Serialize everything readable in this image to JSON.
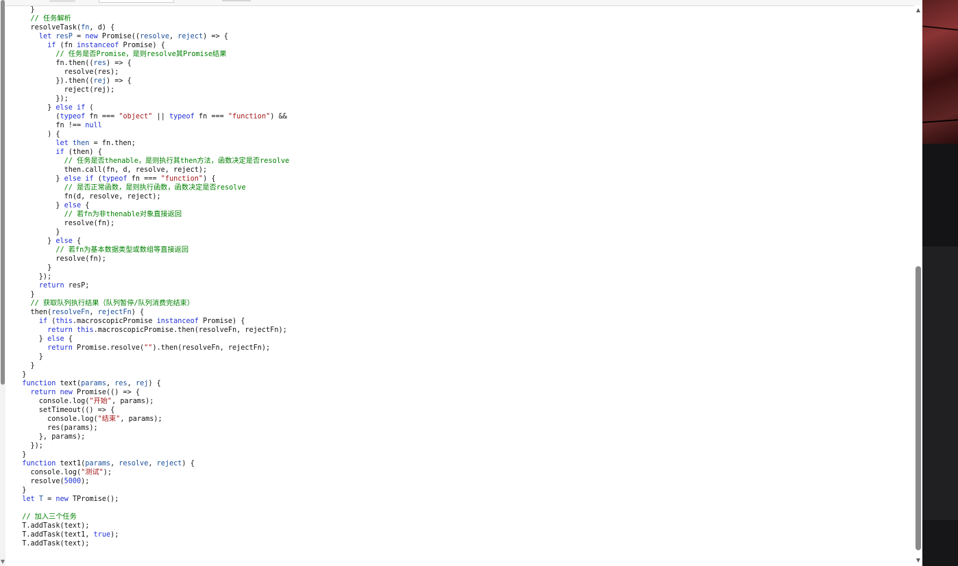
{
  "code": {
    "lines": [
      [
        {
          "t": "    }",
          "c": "plain"
        }
      ],
      [
        {
          "t": "    ",
          "c": "plain"
        },
        {
          "t": "// 任务解析",
          "c": "com"
        }
      ],
      [
        {
          "t": "    resolveTask(",
          "c": "plain"
        },
        {
          "t": "fn",
          "c": "param"
        },
        {
          "t": ", d) {",
          "c": "plain"
        }
      ],
      [
        {
          "t": "      ",
          "c": "plain"
        },
        {
          "t": "let",
          "c": "kw"
        },
        {
          "t": " ",
          "c": "plain"
        },
        {
          "t": "resP",
          "c": "param"
        },
        {
          "t": " = ",
          "c": "plain"
        },
        {
          "t": "new",
          "c": "kw"
        },
        {
          "t": " Promise((",
          "c": "plain"
        },
        {
          "t": "resolve",
          "c": "param"
        },
        {
          "t": ", ",
          "c": "plain"
        },
        {
          "t": "reject",
          "c": "param"
        },
        {
          "t": ") => {",
          "c": "plain"
        }
      ],
      [
        {
          "t": "        ",
          "c": "plain"
        },
        {
          "t": "if",
          "c": "kw"
        },
        {
          "t": " (fn ",
          "c": "plain"
        },
        {
          "t": "instanceof",
          "c": "kw"
        },
        {
          "t": " Promise) {",
          "c": "plain"
        }
      ],
      [
        {
          "t": "          ",
          "c": "plain"
        },
        {
          "t": "// 任务是否Promise，是则resolve其Promise结果",
          "c": "com"
        }
      ],
      [
        {
          "t": "          fn.then((",
          "c": "plain"
        },
        {
          "t": "res",
          "c": "param"
        },
        {
          "t": ") => {",
          "c": "plain"
        }
      ],
      [
        {
          "t": "            resolve(res);",
          "c": "plain"
        }
      ],
      [
        {
          "t": "          }).then((",
          "c": "plain"
        },
        {
          "t": "rej",
          "c": "param"
        },
        {
          "t": ") => {",
          "c": "plain"
        }
      ],
      [
        {
          "t": "            reject(rej);",
          "c": "plain"
        }
      ],
      [
        {
          "t": "          });",
          "c": "plain"
        }
      ],
      [
        {
          "t": "        } ",
          "c": "plain"
        },
        {
          "t": "else if",
          "c": "kw"
        },
        {
          "t": " (",
          "c": "plain"
        }
      ],
      [
        {
          "t": "          (",
          "c": "plain"
        },
        {
          "t": "typeof",
          "c": "kw"
        },
        {
          "t": " fn === ",
          "c": "plain"
        },
        {
          "t": "\"object\"",
          "c": "str"
        },
        {
          "t": " || ",
          "c": "plain"
        },
        {
          "t": "typeof",
          "c": "kw"
        },
        {
          "t": " fn === ",
          "c": "plain"
        },
        {
          "t": "\"function\"",
          "c": "str"
        },
        {
          "t": ") &&",
          "c": "plain"
        }
      ],
      [
        {
          "t": "          fn !== ",
          "c": "plain"
        },
        {
          "t": "null",
          "c": "kw"
        }
      ],
      [
        {
          "t": "        ) {",
          "c": "plain"
        }
      ],
      [
        {
          "t": "          ",
          "c": "plain"
        },
        {
          "t": "let",
          "c": "kw"
        },
        {
          "t": " ",
          "c": "plain"
        },
        {
          "t": "then",
          "c": "param"
        },
        {
          "t": " = fn.then;",
          "c": "plain"
        }
      ],
      [
        {
          "t": "          ",
          "c": "plain"
        },
        {
          "t": "if",
          "c": "kw"
        },
        {
          "t": " (then) {",
          "c": "plain"
        }
      ],
      [
        {
          "t": "            ",
          "c": "plain"
        },
        {
          "t": "// 任务是否thenable，是则执行其then方法，函数决定是否resolve",
          "c": "com"
        }
      ],
      [
        {
          "t": "            then.call(fn, d, resolve, reject);",
          "c": "plain"
        }
      ],
      [
        {
          "t": "          } ",
          "c": "plain"
        },
        {
          "t": "else if",
          "c": "kw"
        },
        {
          "t": " (",
          "c": "plain"
        },
        {
          "t": "typeof",
          "c": "kw"
        },
        {
          "t": " fn === ",
          "c": "plain"
        },
        {
          "t": "\"function\"",
          "c": "str"
        },
        {
          "t": ") {",
          "c": "plain"
        }
      ],
      [
        {
          "t": "            ",
          "c": "plain"
        },
        {
          "t": "// 是否正常函数，是则执行函数，函数决定是否resolve",
          "c": "com"
        }
      ],
      [
        {
          "t": "            fn(d, resolve, reject);",
          "c": "plain"
        }
      ],
      [
        {
          "t": "          } ",
          "c": "plain"
        },
        {
          "t": "else",
          "c": "kw"
        },
        {
          "t": " {",
          "c": "plain"
        }
      ],
      [
        {
          "t": "            ",
          "c": "plain"
        },
        {
          "t": "// 若fn为非thenable对象直接返回",
          "c": "com"
        }
      ],
      [
        {
          "t": "            resolve(fn);",
          "c": "plain"
        }
      ],
      [
        {
          "t": "          }",
          "c": "plain"
        }
      ],
      [
        {
          "t": "        } ",
          "c": "plain"
        },
        {
          "t": "else",
          "c": "kw"
        },
        {
          "t": " {",
          "c": "plain"
        }
      ],
      [
        {
          "t": "          ",
          "c": "plain"
        },
        {
          "t": "// 若fn为基本数据类型或数组等直接返回",
          "c": "com"
        }
      ],
      [
        {
          "t": "          resolve(fn);",
          "c": "plain"
        }
      ],
      [
        {
          "t": "        }",
          "c": "plain"
        }
      ],
      [
        {
          "t": "      });",
          "c": "plain"
        }
      ],
      [
        {
          "t": "      ",
          "c": "plain"
        },
        {
          "t": "return",
          "c": "kw"
        },
        {
          "t": " resP;",
          "c": "plain"
        }
      ],
      [
        {
          "t": "    }",
          "c": "plain"
        }
      ],
      [
        {
          "t": "    ",
          "c": "plain"
        },
        {
          "t": "// 获取队列执行结果（队列暂停/队列消费完结束）",
          "c": "com"
        }
      ],
      [
        {
          "t": "    then(",
          "c": "plain"
        },
        {
          "t": "resolveFn",
          "c": "param"
        },
        {
          "t": ", ",
          "c": "plain"
        },
        {
          "t": "rejectFn",
          "c": "param"
        },
        {
          "t": ") {",
          "c": "plain"
        }
      ],
      [
        {
          "t": "      ",
          "c": "plain"
        },
        {
          "t": "if",
          "c": "kw"
        },
        {
          "t": " (",
          "c": "plain"
        },
        {
          "t": "this",
          "c": "kw"
        },
        {
          "t": ".macroscopicPromise ",
          "c": "plain"
        },
        {
          "t": "instanceof",
          "c": "kw"
        },
        {
          "t": " Promise) {",
          "c": "plain"
        }
      ],
      [
        {
          "t": "        ",
          "c": "plain"
        },
        {
          "t": "return",
          "c": "kw"
        },
        {
          "t": " ",
          "c": "plain"
        },
        {
          "t": "this",
          "c": "kw"
        },
        {
          "t": ".macroscopicPromise.then(resolveFn, rejectFn);",
          "c": "plain"
        }
      ],
      [
        {
          "t": "      } ",
          "c": "plain"
        },
        {
          "t": "else",
          "c": "kw"
        },
        {
          "t": " {",
          "c": "plain"
        }
      ],
      [
        {
          "t": "        ",
          "c": "plain"
        },
        {
          "t": "return",
          "c": "kw"
        },
        {
          "t": " Promise.resolve(",
          "c": "plain"
        },
        {
          "t": "\"\"",
          "c": "str"
        },
        {
          "t": ").then(resolveFn, rejectFn);",
          "c": "plain"
        }
      ],
      [
        {
          "t": "      }",
          "c": "plain"
        }
      ],
      [
        {
          "t": "    }",
          "c": "plain"
        }
      ],
      [
        {
          "t": "  }",
          "c": "plain"
        }
      ],
      [
        {
          "t": "  ",
          "c": "plain"
        },
        {
          "t": "function",
          "c": "kw"
        },
        {
          "t": " text(",
          "c": "plain"
        },
        {
          "t": "params",
          "c": "param"
        },
        {
          "t": ", ",
          "c": "plain"
        },
        {
          "t": "res",
          "c": "param"
        },
        {
          "t": ", ",
          "c": "plain"
        },
        {
          "t": "rej",
          "c": "param"
        },
        {
          "t": ") {",
          "c": "plain"
        }
      ],
      [
        {
          "t": "    ",
          "c": "plain"
        },
        {
          "t": "return",
          "c": "kw"
        },
        {
          "t": " ",
          "c": "plain"
        },
        {
          "t": "new",
          "c": "kw"
        },
        {
          "t": " Promise(() => {",
          "c": "plain"
        }
      ],
      [
        {
          "t": "      console.log(",
          "c": "plain"
        },
        {
          "t": "\"开始\"",
          "c": "str"
        },
        {
          "t": ", params);",
          "c": "plain"
        }
      ],
      [
        {
          "t": "      setTimeout(() => {",
          "c": "plain"
        }
      ],
      [
        {
          "t": "        console.log(",
          "c": "plain"
        },
        {
          "t": "\"结束\"",
          "c": "str"
        },
        {
          "t": ", params);",
          "c": "plain"
        }
      ],
      [
        {
          "t": "        res(params);",
          "c": "plain"
        }
      ],
      [
        {
          "t": "      }, params);",
          "c": "plain"
        }
      ],
      [
        {
          "t": "    });",
          "c": "plain"
        }
      ],
      [
        {
          "t": "  }",
          "c": "plain"
        }
      ],
      [
        {
          "t": "  ",
          "c": "plain"
        },
        {
          "t": "function",
          "c": "kw"
        },
        {
          "t": " text1(",
          "c": "plain"
        },
        {
          "t": "params",
          "c": "param"
        },
        {
          "t": ", ",
          "c": "plain"
        },
        {
          "t": "resolve",
          "c": "param"
        },
        {
          "t": ", ",
          "c": "plain"
        },
        {
          "t": "reject",
          "c": "param"
        },
        {
          "t": ") {",
          "c": "plain"
        }
      ],
      [
        {
          "t": "    console.log(",
          "c": "plain"
        },
        {
          "t": "\"测试\"",
          "c": "str"
        },
        {
          "t": ");",
          "c": "plain"
        }
      ],
      [
        {
          "t": "    resolve(",
          "c": "plain"
        },
        {
          "t": "5000",
          "c": "num"
        },
        {
          "t": ");",
          "c": "plain"
        }
      ],
      [
        {
          "t": "  }",
          "c": "plain"
        }
      ],
      [
        {
          "t": "  ",
          "c": "plain"
        },
        {
          "t": "let",
          "c": "kw"
        },
        {
          "t": " ",
          "c": "plain"
        },
        {
          "t": "T",
          "c": "param"
        },
        {
          "t": " = ",
          "c": "plain"
        },
        {
          "t": "new",
          "c": "kw"
        },
        {
          "t": " TPromise();",
          "c": "plain"
        }
      ],
      [
        {
          "t": "",
          "c": "plain"
        }
      ],
      [
        {
          "t": "  ",
          "c": "plain"
        },
        {
          "t": "// 加入三个任务",
          "c": "com"
        }
      ],
      [
        {
          "t": "  T.addTask(text);",
          "c": "plain"
        }
      ],
      [
        {
          "t": "  T.addTask(text1, ",
          "c": "plain"
        },
        {
          "t": "true",
          "c": "kw"
        },
        {
          "t": ");",
          "c": "plain"
        }
      ],
      [
        {
          "t": "  T.addTask(text);",
          "c": "plain"
        }
      ]
    ]
  },
  "scrollbar": {
    "up_icon": "▲",
    "down_icon": "▼",
    "position_fraction": 0.62
  },
  "left_scrollbar": {
    "down_icon": "▼"
  },
  "toolbar": {
    "chevron_icon": "⌃"
  },
  "colors": {
    "keyword": "#1f2fd6",
    "string": "#a31515",
    "comment": "#008000",
    "param": "#1a4f9c"
  }
}
